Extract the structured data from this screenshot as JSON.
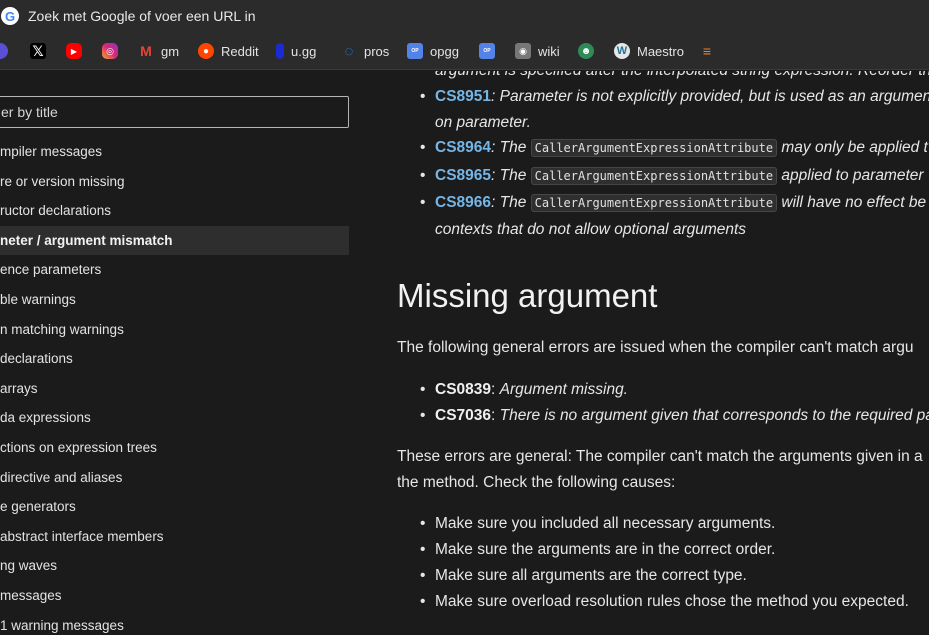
{
  "browser": {
    "address_text": "Zoek met Google of voer een URL in",
    "google_letter": "G",
    "bookmarks": [
      {
        "label": "",
        "icon": "circle-icon",
        "color": "#5b4fd6"
      },
      {
        "label": "",
        "icon": "x-icon",
        "color": "#000000"
      },
      {
        "label": "",
        "icon": "youtube-icon",
        "color": "#ff0000"
      },
      {
        "label": "",
        "icon": "instagram-icon",
        "color": "#d62976"
      },
      {
        "label": "gm",
        "icon": "gmail-icon",
        "color": "#ea4335"
      },
      {
        "label": "Reddit",
        "icon": "reddit-icon",
        "color": "#ff4500"
      },
      {
        "label": "u.gg",
        "icon": "ugg-icon",
        "color": "#1b2bd1"
      },
      {
        "label": "pros",
        "icon": "pros-icon",
        "color": "#1e90ff"
      },
      {
        "label": "opgg",
        "icon": "opgg-icon",
        "color": "#5383e8"
      },
      {
        "label": "",
        "icon": "opgg-icon",
        "color": "#5383e8"
      },
      {
        "label": "wiki",
        "icon": "wiki-icon",
        "color": "#555555"
      },
      {
        "label": "",
        "icon": "android-icon",
        "color": "#2e8b57"
      },
      {
        "label": "Maestro",
        "icon": "wordpress-icon",
        "color": "#21759b"
      },
      {
        "label": "",
        "icon": "stackoverflow-icon",
        "color": "#f48024"
      }
    ]
  },
  "sidebar": {
    "filter_placeholder": "er by title",
    "items": [
      {
        "label": "mpiler messages",
        "active": false
      },
      {
        "label": "re or version missing",
        "active": false
      },
      {
        "label": "ructor declarations",
        "active": false
      },
      {
        "label": "neter / argument mismatch",
        "active": true
      },
      {
        "label": "ence parameters",
        "active": false
      },
      {
        "label": "ble warnings",
        "active": false
      },
      {
        "label": "n matching warnings",
        "active": false
      },
      {
        "label": "declarations",
        "active": false
      },
      {
        "label": "arrays",
        "active": false
      },
      {
        "label": "da expressions",
        "active": false
      },
      {
        "label": "ctions on expression trees",
        "active": false
      },
      {
        "label": "directive and aliases",
        "active": false
      },
      {
        "label": "e generators",
        "active": false
      },
      {
        "label": "abstract interface members",
        "active": false
      },
      {
        "label": "ng waves",
        "active": false
      },
      {
        "label": "messages",
        "active": false
      },
      {
        "label": "1 warning messages",
        "active": false
      }
    ]
  },
  "main": {
    "top_fragment": "argument is specified after the interpolated string expression. Reorder th",
    "error_list": [
      {
        "code": "CS8951",
        "text_before": ": Parameter is not explicitly provided, but is used as an argument",
        "code_text": "",
        "text_after": "",
        "continuation": "on parameter."
      },
      {
        "code": "CS8964",
        "text_before": ": The ",
        "code_text": "CallerArgumentExpressionAttribute",
        "text_after": " may only be applied t",
        "continuation": ""
      },
      {
        "code": "CS8965",
        "text_before": ": The ",
        "code_text": "CallerArgumentExpressionAttribute",
        "text_after": " applied to parameter",
        "continuation": ""
      },
      {
        "code": "CS8966",
        "text_before": ": The ",
        "code_text": "CallerArgumentExpressionAttribute",
        "text_after": " will have no effect be",
        "continuation": "contexts that do not allow optional arguments"
      }
    ],
    "heading": "Missing argument",
    "intro": "The following general errors are issued when the compiler can't match argu",
    "missing_list": [
      {
        "code": "CS0839",
        "text": ": ",
        "italic": "Argument missing."
      },
      {
        "code": "CS7036",
        "text": ": ",
        "italic": "There is no argument given that corresponds to the required pa"
      }
    ],
    "general_line1": "These errors are general: The compiler can't match the arguments given in a",
    "general_line2": "the method. Check the following causes:",
    "causes": [
      "Make sure you included all necessary arguments.",
      "Make sure the arguments are in the correct order.",
      "Make sure all arguments are the correct type.",
      "Make sure overload resolution rules chose the method you expected."
    ]
  }
}
